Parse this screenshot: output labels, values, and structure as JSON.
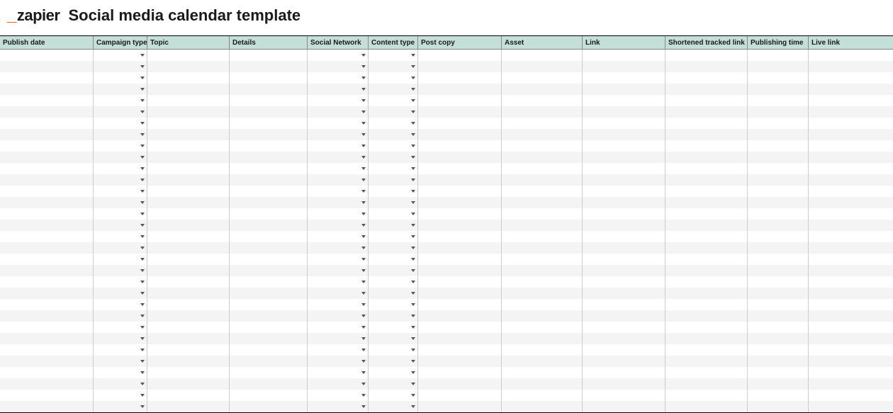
{
  "logo": {
    "prefix": "_",
    "text": "zapier"
  },
  "title": "Social media calendar template",
  "columns": [
    {
      "label": "Publish date",
      "dropdown": false
    },
    {
      "label": "Campaign type",
      "dropdown": true
    },
    {
      "label": "Topic",
      "dropdown": false
    },
    {
      "label": "Details",
      "dropdown": false
    },
    {
      "label": "Social Network",
      "dropdown": true
    },
    {
      "label": "Content type",
      "dropdown": true
    },
    {
      "label": "Post copy",
      "dropdown": false
    },
    {
      "label": "Asset",
      "dropdown": false
    },
    {
      "label": "Link",
      "dropdown": false
    },
    {
      "label": "Shortened tracked link",
      "dropdown": false
    },
    {
      "label": "Publishing time",
      "dropdown": false
    },
    {
      "label": "Live link",
      "dropdown": false
    }
  ],
  "row_count": 32
}
